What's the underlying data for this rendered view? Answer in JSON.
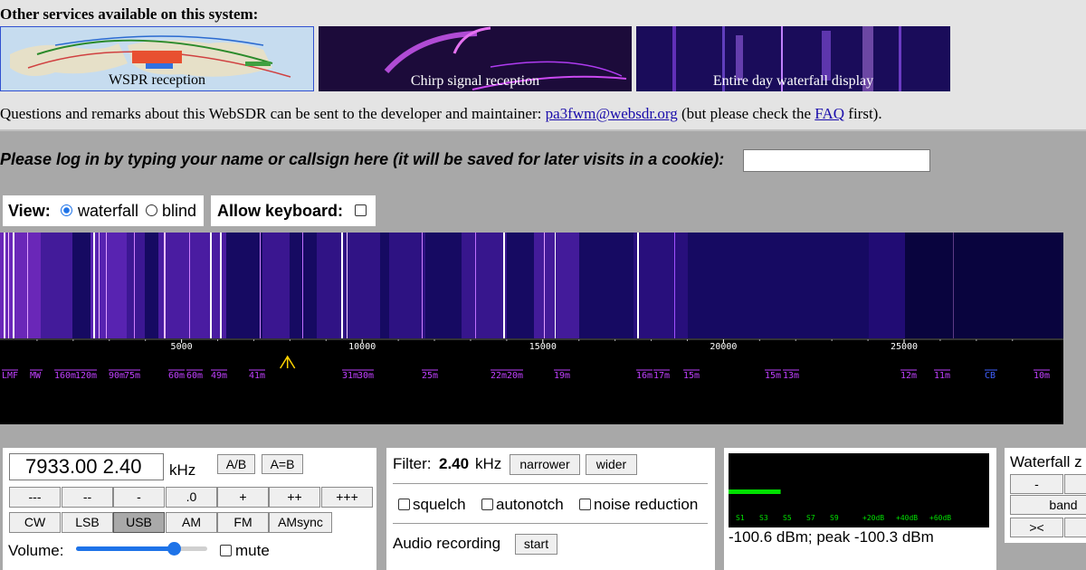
{
  "services": {
    "title": "Other services available on this system:",
    "items": [
      {
        "label": "WSPR reception"
      },
      {
        "label": "Chirp signal reception"
      },
      {
        "label": "Entire day waterfall display"
      }
    ]
  },
  "questions": {
    "prefix": "Questions and remarks about this WebSDR can be sent to the developer and maintainer: ",
    "email": "pa3fwm@websdr.org",
    "middle": " (but please check the ",
    "faq": "FAQ",
    "suffix": " first)."
  },
  "login": {
    "prompt": "Please log in by typing your name or callsign here (it will be saved for later visits in a cookie):",
    "value": ""
  },
  "view": {
    "label": "View:",
    "options": [
      "waterfall",
      "blind"
    ],
    "selected": "waterfall",
    "keyboard_label": "Allow keyboard:",
    "keyboard_checked": false
  },
  "scale": {
    "freq_labels": [
      "5000",
      "10000",
      "15000",
      "20000",
      "25000"
    ],
    "freq_values": [
      5000,
      10000,
      15000,
      20000,
      25000
    ],
    "bands": [
      "LMF",
      "MW",
      "160m",
      "120m",
      "90m",
      "75m",
      "60m",
      "60m",
      "49m",
      "41m",
      "31m",
      "30m",
      "25m",
      "22m",
      "20m",
      "19m",
      "16m",
      "17m",
      "15m",
      "15m",
      "13m",
      "12m",
      "11m",
      "CB",
      "10m"
    ],
    "tuned_khz": 7933
  },
  "tuning": {
    "frequency": "7933.00 2.40",
    "unit": "kHz",
    "ab_label": "A/B",
    "aeqb_label": "A=B",
    "step_buttons": [
      "---",
      "--",
      "-",
      ".0",
      "+",
      "++",
      "+++"
    ],
    "modes": [
      "CW",
      "LSB",
      "USB",
      "AM",
      "FM",
      "AMsync"
    ],
    "active_mode": "USB",
    "volume_label": "Volume:",
    "volume_level": 0.75,
    "mute_label": "mute"
  },
  "filter": {
    "label": "Filter:",
    "value": "2.40",
    "unit": "kHz",
    "narrower": "narrower",
    "wider": "wider",
    "squelch": "squelch",
    "autonotch": "autonotch",
    "noise_reduction": "noise reduction",
    "audio_recording": "Audio recording",
    "start": "start"
  },
  "smeter": {
    "marks": [
      "S1",
      "S3",
      "S5",
      "S7",
      "S9",
      "+20dB",
      "+40dB",
      "+60dB"
    ],
    "level_fraction": 0.2,
    "readout": "-100.6 dBm; peak -100.3 dBm",
    "bar_color": "#00e000"
  },
  "waterfall_zoom": {
    "title": "Waterfall z",
    "minus": "-",
    "band": "band",
    "arrows": "><"
  },
  "colors": {
    "waterfall_bg": "#160a62",
    "accent_purple": "#b040ff",
    "freq_label": "#ffffff",
    "band_label": "#c040ff",
    "cb_label": "#4060ff"
  }
}
